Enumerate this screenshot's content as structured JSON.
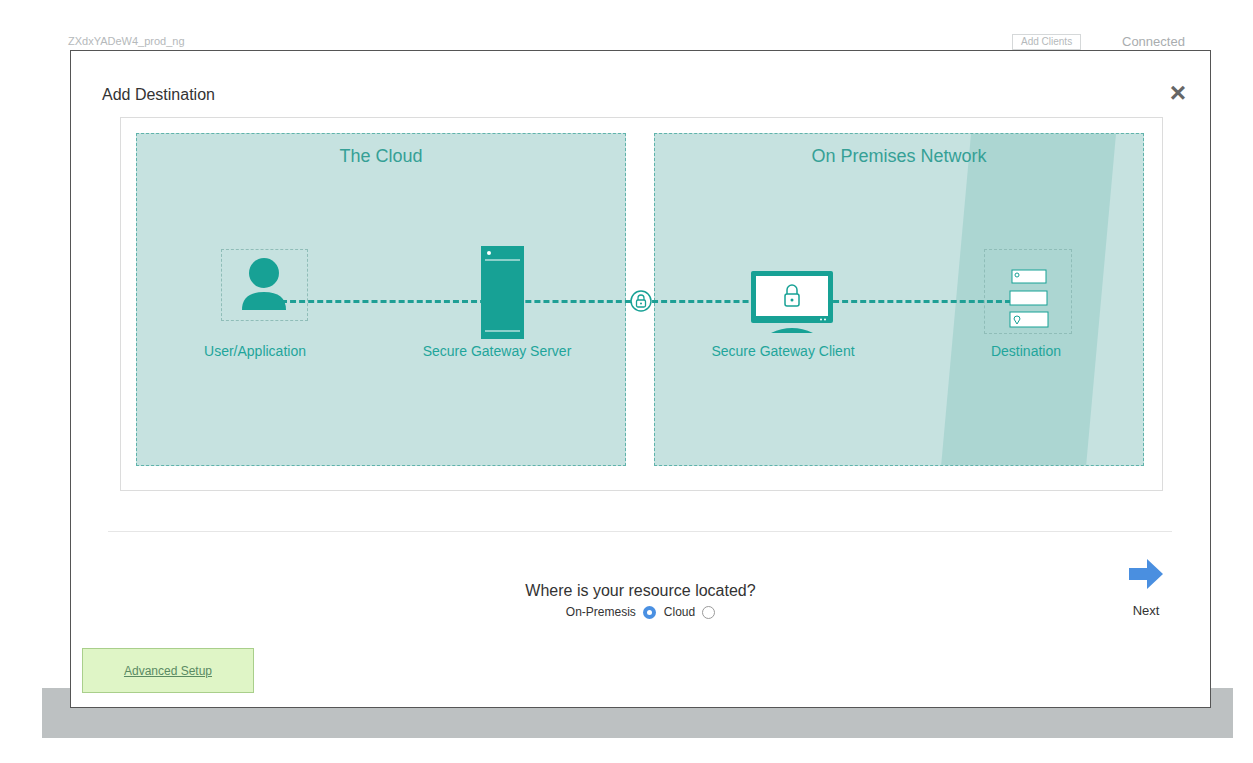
{
  "background": {
    "app_title": "ZXdxYADeW4_prod_ng",
    "button": "Add Clients",
    "status": "Connected"
  },
  "dialog": {
    "title": "Add Destination",
    "close": "×"
  },
  "diagram": {
    "zones": [
      {
        "title": "The Cloud"
      },
      {
        "title": "On Premises Network"
      }
    ],
    "nodes": [
      {
        "label": "User/Application",
        "kind": "user"
      },
      {
        "label": "Secure Gateway Server",
        "kind": "server"
      },
      {
        "label": "Secure Gateway Client",
        "kind": "client"
      },
      {
        "label": "Destination",
        "kind": "destination"
      }
    ]
  },
  "question": {
    "prompt": "Where is your resource located?",
    "options": [
      {
        "label": "On-Premesis",
        "selected": true
      },
      {
        "label": "Cloud",
        "selected": false
      }
    ]
  },
  "next": {
    "label": "Next"
  },
  "advanced": {
    "label": "Advanced Setup"
  }
}
